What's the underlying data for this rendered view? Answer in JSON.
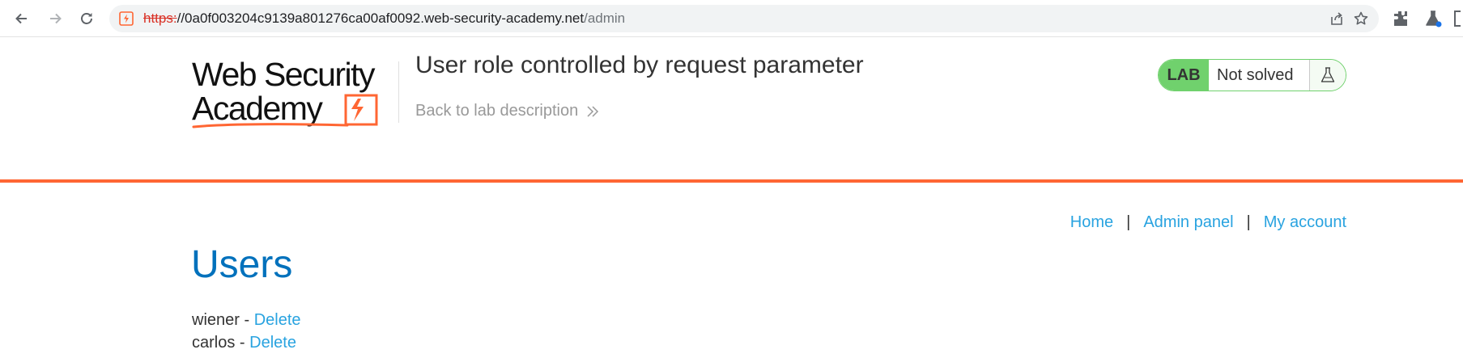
{
  "browser": {
    "url_scheme": "https:",
    "url_host": "//0a0f003204c9139a801276ca00af0092.web-security-academy.net",
    "url_path": "/admin",
    "icons": [
      "back-arrow-icon",
      "forward-arrow-icon",
      "reload-icon",
      "site-warning-icon",
      "share-icon",
      "bookmark-star-icon",
      "extensions-icon",
      "lab-flask-extension-icon"
    ]
  },
  "header": {
    "logo_text": "Web Security Academy",
    "lab_title": "User role controlled by request parameter",
    "back_link": "Back to lab description",
    "lab_badge": "LAB",
    "status": "Not solved"
  },
  "nav": {
    "home": "Home",
    "admin_panel": "Admin panel",
    "my_account": "My account",
    "separator": "|"
  },
  "main": {
    "heading": "Users",
    "users": [
      {
        "name": "wiener",
        "separator": " - ",
        "action": "Delete"
      },
      {
        "name": "carlos",
        "separator": " - ",
        "action": "Delete"
      }
    ]
  },
  "colors": {
    "accent": "#ff6633",
    "heading_blue": "#0071bc",
    "link_blue": "#29a3e0",
    "lab_green": "#70d16d"
  }
}
